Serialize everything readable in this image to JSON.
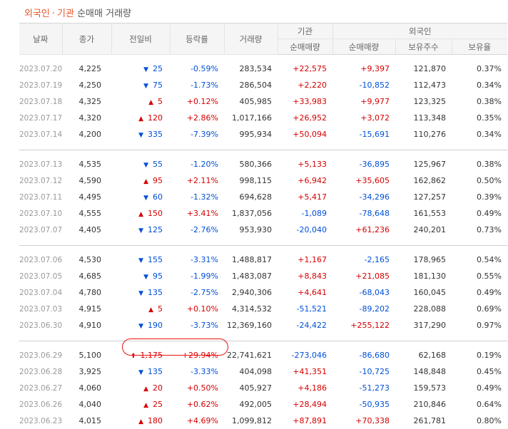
{
  "title": {
    "part1": "외국인",
    "sep": "·",
    "part2": "기관",
    "part3": "순매매 거래량"
  },
  "headers": {
    "date": "날짜",
    "close": "종가",
    "change": "전일비",
    "rate": "등락률",
    "volume": "거래량",
    "inst": "기관",
    "foreign": "외국인",
    "inst_net": "순매매량",
    "foreign_net": "순매매량",
    "holdings": "보유주수",
    "ratio": "보유율"
  },
  "groups": [
    [
      {
        "date": "2023.07.20",
        "close": "4,225",
        "dir": "down",
        "change": "25",
        "rate": "-0.59%",
        "volume": "283,534",
        "inst": "+22,575",
        "foreign": "+9,397",
        "holdings": "121,870",
        "ratio": "0.37%"
      },
      {
        "date": "2023.07.19",
        "close": "4,250",
        "dir": "down",
        "change": "75",
        "rate": "-1.73%",
        "volume": "286,504",
        "inst": "+2,220",
        "foreign": "-10,852",
        "holdings": "112,473",
        "ratio": "0.34%"
      },
      {
        "date": "2023.07.18",
        "close": "4,325",
        "dir": "up",
        "change": "5",
        "rate": "+0.12%",
        "volume": "405,985",
        "inst": "+33,983",
        "foreign": "+9,977",
        "holdings": "123,325",
        "ratio": "0.38%"
      },
      {
        "date": "2023.07.17",
        "close": "4,320",
        "dir": "up",
        "change": "120",
        "rate": "+2.86%",
        "volume": "1,017,166",
        "inst": "+26,952",
        "foreign": "+3,072",
        "holdings": "113,348",
        "ratio": "0.35%"
      },
      {
        "date": "2023.07.14",
        "close": "4,200",
        "dir": "down",
        "change": "335",
        "rate": "-7.39%",
        "volume": "995,934",
        "inst": "+50,094",
        "foreign": "-15,691",
        "holdings": "110,276",
        "ratio": "0.34%"
      }
    ],
    [
      {
        "date": "2023.07.13",
        "close": "4,535",
        "dir": "down",
        "change": "55",
        "rate": "-1.20%",
        "volume": "580,366",
        "inst": "+5,133",
        "foreign": "-36,895",
        "holdings": "125,967",
        "ratio": "0.38%"
      },
      {
        "date": "2023.07.12",
        "close": "4,590",
        "dir": "up",
        "change": "95",
        "rate": "+2.11%",
        "volume": "998,115",
        "inst": "+6,942",
        "foreign": "+35,605",
        "holdings": "162,862",
        "ratio": "0.50%"
      },
      {
        "date": "2023.07.11",
        "close": "4,495",
        "dir": "down",
        "change": "60",
        "rate": "-1.32%",
        "volume": "694,628",
        "inst": "+5,417",
        "foreign": "-34,296",
        "holdings": "127,257",
        "ratio": "0.39%"
      },
      {
        "date": "2023.07.10",
        "close": "4,555",
        "dir": "up",
        "change": "150",
        "rate": "+3.41%",
        "volume": "1,837,056",
        "inst": "-1,089",
        "foreign": "-78,648",
        "holdings": "161,553",
        "ratio": "0.49%"
      },
      {
        "date": "2023.07.07",
        "close": "4,405",
        "dir": "down",
        "change": "125",
        "rate": "-2.76%",
        "volume": "953,930",
        "inst": "-20,040",
        "foreign": "+61,236",
        "holdings": "240,201",
        "ratio": "0.73%"
      }
    ],
    [
      {
        "date": "2023.07.06",
        "close": "4,530",
        "dir": "down",
        "change": "155",
        "rate": "-3.31%",
        "volume": "1,488,817",
        "inst": "+1,167",
        "foreign": "-2,165",
        "holdings": "178,965",
        "ratio": "0.54%"
      },
      {
        "date": "2023.07.05",
        "close": "4,685",
        "dir": "down",
        "change": "95",
        "rate": "-1.99%",
        "volume": "1,483,087",
        "inst": "+8,843",
        "foreign": "+21,085",
        "holdings": "181,130",
        "ratio": "0.55%"
      },
      {
        "date": "2023.07.04",
        "close": "4,780",
        "dir": "down",
        "change": "135",
        "rate": "-2.75%",
        "volume": "2,940,306",
        "inst": "+4,641",
        "foreign": "-68,043",
        "holdings": "160,045",
        "ratio": "0.49%"
      },
      {
        "date": "2023.07.03",
        "close": "4,915",
        "dir": "up",
        "change": "5",
        "rate": "+0.10%",
        "volume": "4,314,532",
        "inst": "-51,521",
        "foreign": "-89,202",
        "holdings": "228,088",
        "ratio": "0.69%"
      },
      {
        "date": "2023.06.30",
        "close": "4,910",
        "dir": "down",
        "change": "190",
        "rate": "-3.73%",
        "volume": "12,369,160",
        "inst": "-24,422",
        "foreign": "+255,122",
        "holdings": "317,290",
        "ratio": "0.97%"
      }
    ],
    [
      {
        "date": "2023.06.29",
        "close": "5,100",
        "dir": "limit",
        "change": "1,175",
        "rate": "+29.94%",
        "volume": "22,741,621",
        "inst": "-273,046",
        "foreign": "-86,680",
        "holdings": "62,168",
        "ratio": "0.19%"
      },
      {
        "date": "2023.06.28",
        "close": "3,925",
        "dir": "down",
        "change": "135",
        "rate": "-3.33%",
        "volume": "404,098",
        "inst": "+41,351",
        "foreign": "-10,725",
        "holdings": "148,848",
        "ratio": "0.45%"
      },
      {
        "date": "2023.06.27",
        "close": "4,060",
        "dir": "up",
        "change": "20",
        "rate": "+0.50%",
        "volume": "405,927",
        "inst": "+4,186",
        "foreign": "-51,273",
        "holdings": "159,573",
        "ratio": "0.49%"
      },
      {
        "date": "2023.06.26",
        "close": "4,040",
        "dir": "up",
        "change": "25",
        "rate": "+0.62%",
        "volume": "492,005",
        "inst": "+28,494",
        "foreign": "-50,935",
        "holdings": "210,846",
        "ratio": "0.64%"
      },
      {
        "date": "2023.06.23",
        "close": "4,015",
        "dir": "up",
        "change": "180",
        "rate": "+4.69%",
        "volume": "1,099,812",
        "inst": "+87,891",
        "foreign": "+70,338",
        "holdings": "261,781",
        "ratio": "0.80%"
      }
    ]
  ],
  "icons": {
    "up": "triangle-up-icon",
    "down": "triangle-down-icon",
    "limit": "limit-up-arrow-icon"
  },
  "colors": {
    "up": "#d60000",
    "down": "#0050d8",
    "title_accent": "#e8562a",
    "annotation": "#e11111"
  }
}
